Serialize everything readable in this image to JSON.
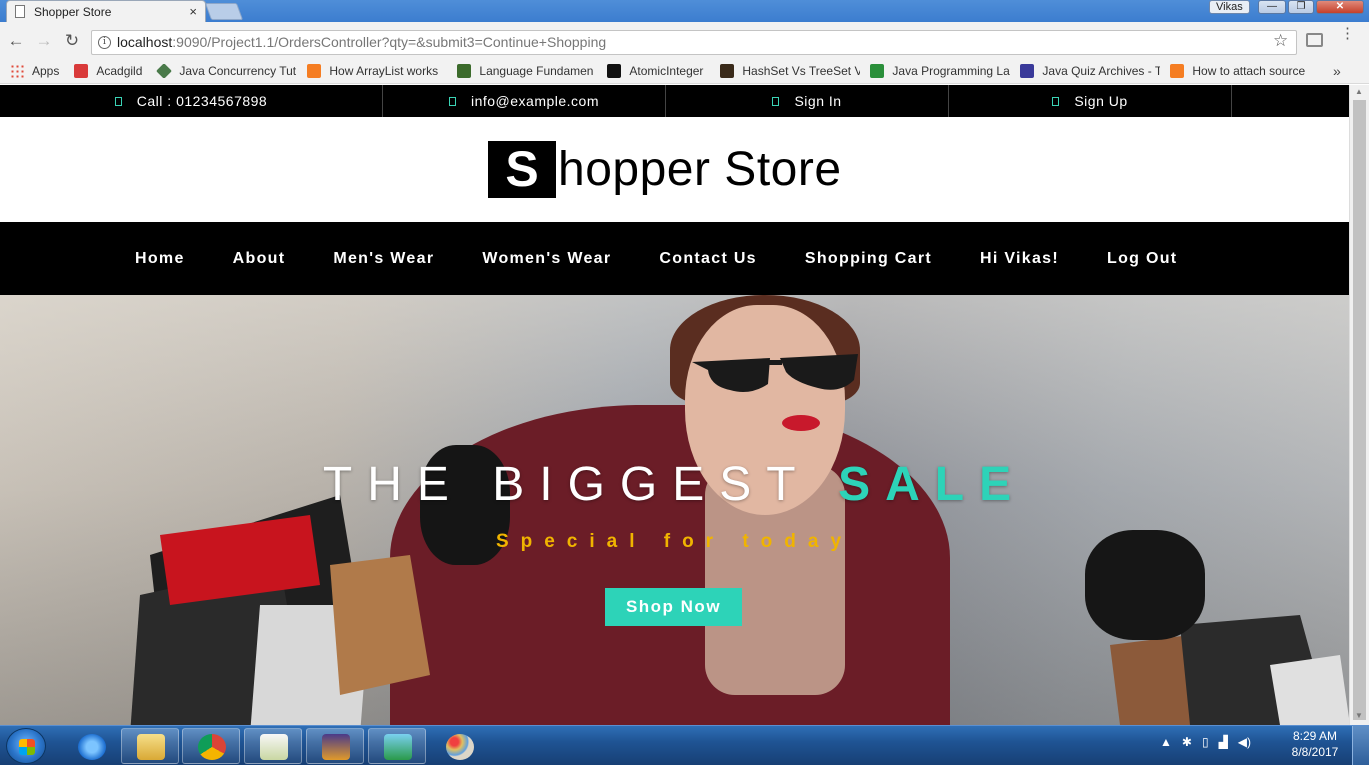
{
  "browser": {
    "tab_title": "Shopper Store",
    "tab_close": "×",
    "user_label": "Vikas",
    "min_label": "—",
    "max_label": "❐",
    "close_label": "✕",
    "url_host": "localhost",
    "url_rest": ":9090/Project1.1/OrdersController?qty=&submit3=Continue+Shopping",
    "back": "←",
    "forward": "→",
    "reload": "↻",
    "star": "☆",
    "more": "»",
    "bookmarks": [
      {
        "label": "Apps",
        "color": "#e04a3a"
      },
      {
        "label": "Acadgild",
        "color": "#d93a3a"
      },
      {
        "label": "Java Concurrency Tut",
        "color": "#4a7a4a"
      },
      {
        "label": "How ArrayList works",
        "color": "#f57d22"
      },
      {
        "label": "Language Fundamen",
        "color": "#3c6b2c"
      },
      {
        "label": "AtomicInteger",
        "color": "#111111"
      },
      {
        "label": "HashSet Vs TreeSet V",
        "color": "#3a2a1a"
      },
      {
        "label": "Java Programming La",
        "color": "#2a8f3a"
      },
      {
        "label": "Java Quiz Archives - T",
        "color": "#3a3a9a"
      },
      {
        "label": "How to attach source",
        "color": "#f57d22"
      }
    ]
  },
  "site": {
    "topbar": {
      "call": "Call : 01234567898",
      "email": "info@example.com",
      "sign_in": "Sign In",
      "sign_up": "Sign Up"
    },
    "logo": {
      "initial": "S",
      "rest": "hopper Store"
    },
    "nav": [
      "Home",
      "About",
      "Men's Wear",
      "Women's Wear",
      "Contact Us",
      "Shopping Cart",
      "Hi Vikas!",
      "Log Out"
    ],
    "hero": {
      "title_main": "THE BIGGEST ",
      "title_accent": "SALE",
      "subtitle": "Special for today",
      "button": "Shop Now"
    },
    "colors": {
      "accent": "#2dd3b8",
      "subtitle": "#f0b400",
      "bar": "#000000"
    }
  },
  "taskbar": {
    "time": "8:29 AM",
    "date": "8/8/2017"
  }
}
